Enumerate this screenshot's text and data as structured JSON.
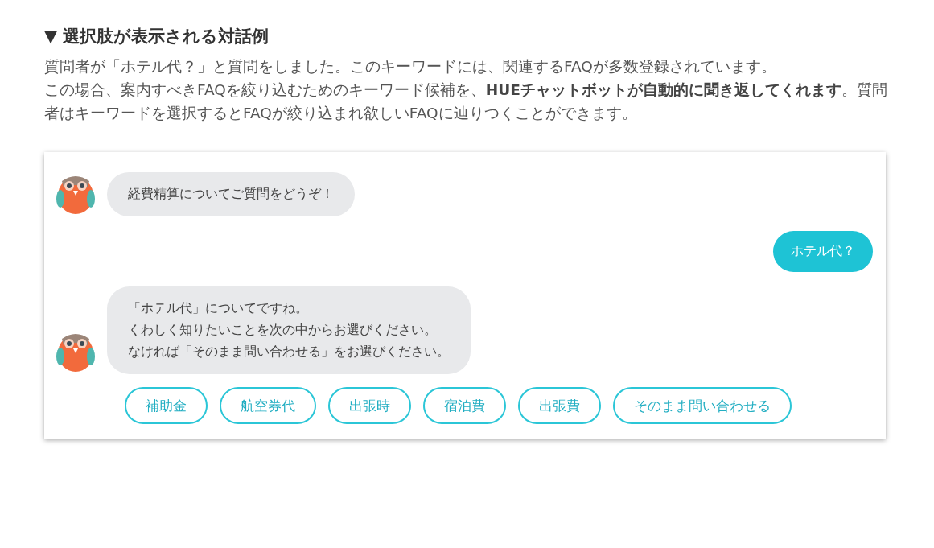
{
  "heading": "▼ 選択肢が表示される対話例",
  "paragraphs": [
    "質問者が「ホテル代？」と質問をしました。このキーワードには、関連するFAQが多数登録されています。",
    "この場合、案内すべきFAQを絞り込むためのキーワード候補を、**HUEチャットボットが自動的に聞き返してくれます**。質問者はキーワードを選択するとFAQが絞り込まれ欲しいFAQに辿りつくことができます。"
  ],
  "chat": {
    "messages": [
      {
        "kind": "bot",
        "lines": [
          "経費精算についてご質問をどうぞ！"
        ]
      },
      {
        "kind": "user",
        "lines": [
          "ホテル代？"
        ]
      },
      {
        "kind": "bot",
        "lines": [
          "「ホテル代」についてですね。",
          "くわしく知りたいことを次の中からお選びください。",
          "なければ「そのまま問い合わせる」をお選びください。"
        ]
      }
    ],
    "choices": [
      "補助金",
      "航空券代",
      "出張時",
      "宿泊費",
      "出張費",
      "そのまま問い合わせる"
    ]
  }
}
